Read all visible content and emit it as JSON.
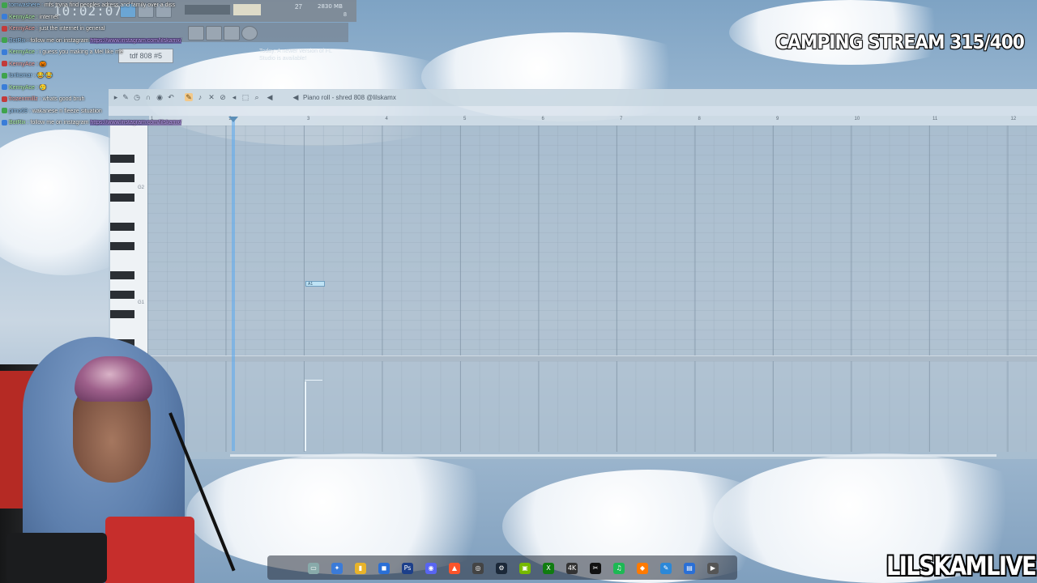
{
  "colors": {
    "sky": "#a9c2d8",
    "piano_roll_bg": "#b2c4d4",
    "playhead": "#5aaaf0",
    "note": "#bfe3f5"
  },
  "fl_topbar": {
    "clock": "10:02:07",
    "cpu_label": "2830 MB",
    "voices": "27",
    "polyphony": "8",
    "pattern_name": "tdf 808 #5",
    "notice_text": "Today: A newer version of FL Studio is available!"
  },
  "chat": [
    {
      "user": "tomwashere",
      "text": "mfs tryna find peoples adress and family over a diss"
    },
    {
      "user": "KennyAce",
      "text": "internet"
    },
    {
      "user": "KennyAce",
      "text": "just the internet in general"
    },
    {
      "user": "BotRix",
      "text": "follow me on instagram",
      "link": "https://www.instagram.com/lilskamx/"
    },
    {
      "user": "KennyAce",
      "text": "i guess you making a Mel like me"
    },
    {
      "user": "KennyAce",
      "text": "🎃"
    },
    {
      "user": "lonkomar",
      "text": "😂 😂"
    },
    {
      "user": "KennyAce",
      "text": "🥲"
    },
    {
      "user": "frozenrmillz",
      "text": "whats good bruh"
    },
    {
      "user": "pimo69",
      "text": "wakanese n fleeze situation"
    },
    {
      "user": "BotRix",
      "text": "follow me on instagram",
      "link": "https://www.instagram.com/lilskamx/"
    }
  ],
  "stream": {
    "title": "CAMPING STREAM 315/400",
    "channel": "LILSKAMLIVE"
  },
  "piano_roll": {
    "title": "Piano roll - shred 808 @lilskamx",
    "bar_numbers": [
      "1",
      "2",
      "3",
      "4",
      "5",
      "6",
      "7",
      "8",
      "9",
      "10",
      "11",
      "12"
    ],
    "key_labels": {
      "g2": "G2",
      "g1": "G1"
    },
    "note_label": "A1"
  },
  "taskbar": {
    "icons": [
      "explorer-icon",
      "copilot-icon",
      "folder-icon",
      "store-icon",
      "photoshop-icon",
      "discord-icon",
      "brave-icon",
      "obs-icon",
      "steam-icon",
      "nvidia-icon",
      "xbox-icon",
      "4k-icon",
      "capcut-icon",
      "spotify-icon",
      "fl-studio-icon",
      "paint-icon",
      "notepad-icon",
      "media-player-icon"
    ]
  }
}
